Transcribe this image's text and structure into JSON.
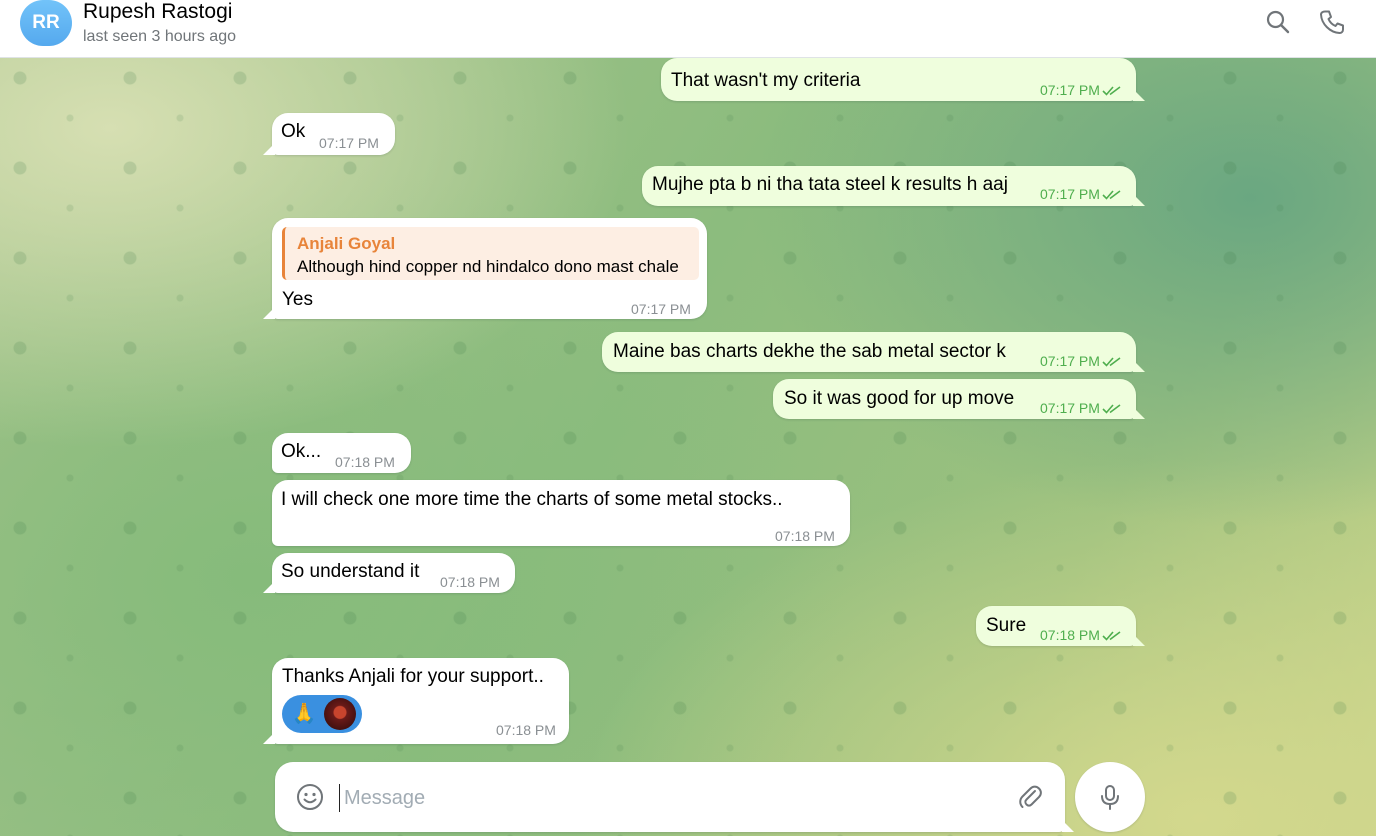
{
  "header": {
    "avatar_initials": "RR",
    "contact_name": "Rupesh Rastogi",
    "status": "last seen 3 hours ago",
    "icons": [
      "search-icon",
      "phone-icon"
    ]
  },
  "messages": [
    {
      "direction": "out",
      "text": "That wasn't my criteria",
      "time": "07:17 PM",
      "read": true
    },
    {
      "direction": "in",
      "text": "Ok",
      "time": "07:17 PM"
    },
    {
      "direction": "out",
      "text": "Mujhe pta b ni tha tata steel k results h aaj",
      "time": "07:17 PM",
      "read": true
    },
    {
      "direction": "in",
      "reply_to_name": "Anjali Goyal",
      "reply_to_text": "Although hind copper nd hindalco dono mast chale",
      "text": "Yes",
      "time": "07:17 PM"
    },
    {
      "direction": "out",
      "text": "Maine bas charts dekhe the sab metal sector k",
      "time": "07:17 PM",
      "read": true
    },
    {
      "direction": "out",
      "text": "So it was good for up move",
      "time": "07:17 PM",
      "read": true
    },
    {
      "direction": "in",
      "text": "Ok...",
      "time": "07:18 PM"
    },
    {
      "direction": "in",
      "text": "I will check one more time the charts of some metal stocks..",
      "time": "07:18 PM"
    },
    {
      "direction": "in",
      "text": "So understand it",
      "time": "07:18 PM"
    },
    {
      "direction": "out",
      "text": "Sure",
      "time": "07:18 PM",
      "read": true
    },
    {
      "direction": "in",
      "text": "Thanks Anjali for your support..",
      "time": "07:18 PM",
      "reaction": "🙏"
    }
  ],
  "composer": {
    "placeholder": "Message",
    "icons": [
      "emoji-icon",
      "attach-icon",
      "microphone-icon"
    ]
  },
  "colors": {
    "outgoing_bubble": "#effedd",
    "incoming_bubble": "#ffffff",
    "time_out": "#4fae4e",
    "reply_accent": "#e8843a",
    "avatar": "#5fb3f4"
  }
}
